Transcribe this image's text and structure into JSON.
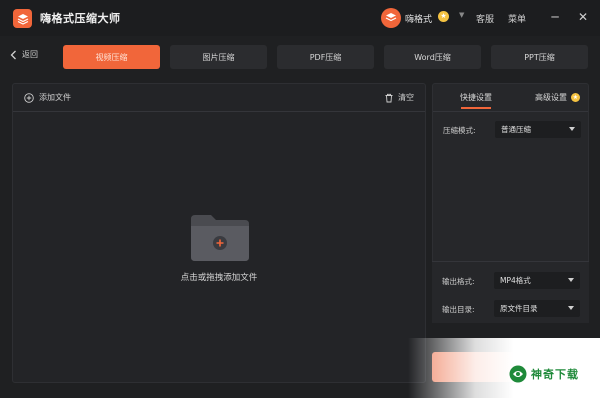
{
  "app": {
    "title": "嗨格式压缩大师"
  },
  "user": {
    "name": "嗨格式"
  },
  "header": {
    "support": "客服",
    "menu": "菜单",
    "minimize": "─",
    "close": "✕"
  },
  "nav": {
    "back": "返回",
    "tabs": [
      {
        "label": "视频压缩",
        "active": true
      },
      {
        "label": "图片压缩",
        "active": false
      },
      {
        "label": "PDF压缩",
        "active": false
      },
      {
        "label": "Word压缩",
        "active": false
      },
      {
        "label": "PPT压缩",
        "active": false
      }
    ]
  },
  "file_panel": {
    "add_file": "添加文件",
    "clear": "清空",
    "drop_hint": "点击或拖拽添加文件"
  },
  "settings": {
    "tabs": {
      "quick": "快捷设置",
      "advanced": "高级设置"
    },
    "compress_mode_label": "压缩模式:",
    "compress_mode_value": "普通压缩",
    "output_format_label": "输出格式:",
    "output_format_value": "MP4格式",
    "output_dir_label": "输出目录:",
    "output_dir_value": "原文件目录"
  },
  "watermark": {
    "text": "神奇下载"
  },
  "colors": {
    "accent": "#f1663a",
    "background": "#1f2022",
    "panel": "#232427"
  }
}
